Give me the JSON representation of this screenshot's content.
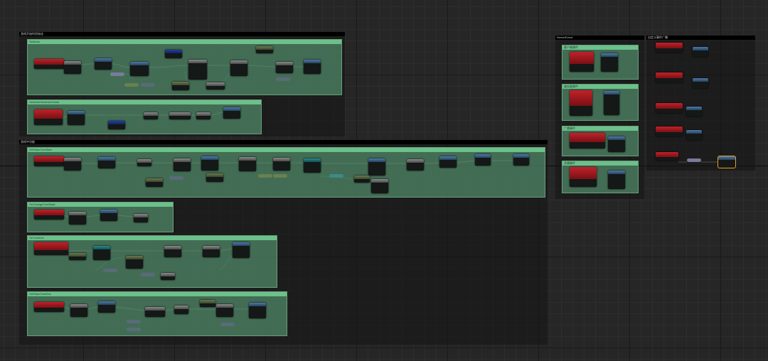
{
  "groups": [
    {
      "title": "游戏开始时初始化",
      "comments": [
        "SetActor",
        "SetActorHiddenInGame"
      ]
    },
    {
      "title": "游戏中功能",
      "comments": [
        "OnPawnTurnStart",
        "OnChangeTurnState",
        "OnTurnEnd",
        "OnPawnTurnEnd"
      ]
    },
    {
      "title": "ServerEvent",
      "comments": [
        "客户端事件",
        "服务器事件",
        "广播事件",
        "多播事件"
      ]
    },
    {
      "title": "自定义事件广播"
    }
  ]
}
